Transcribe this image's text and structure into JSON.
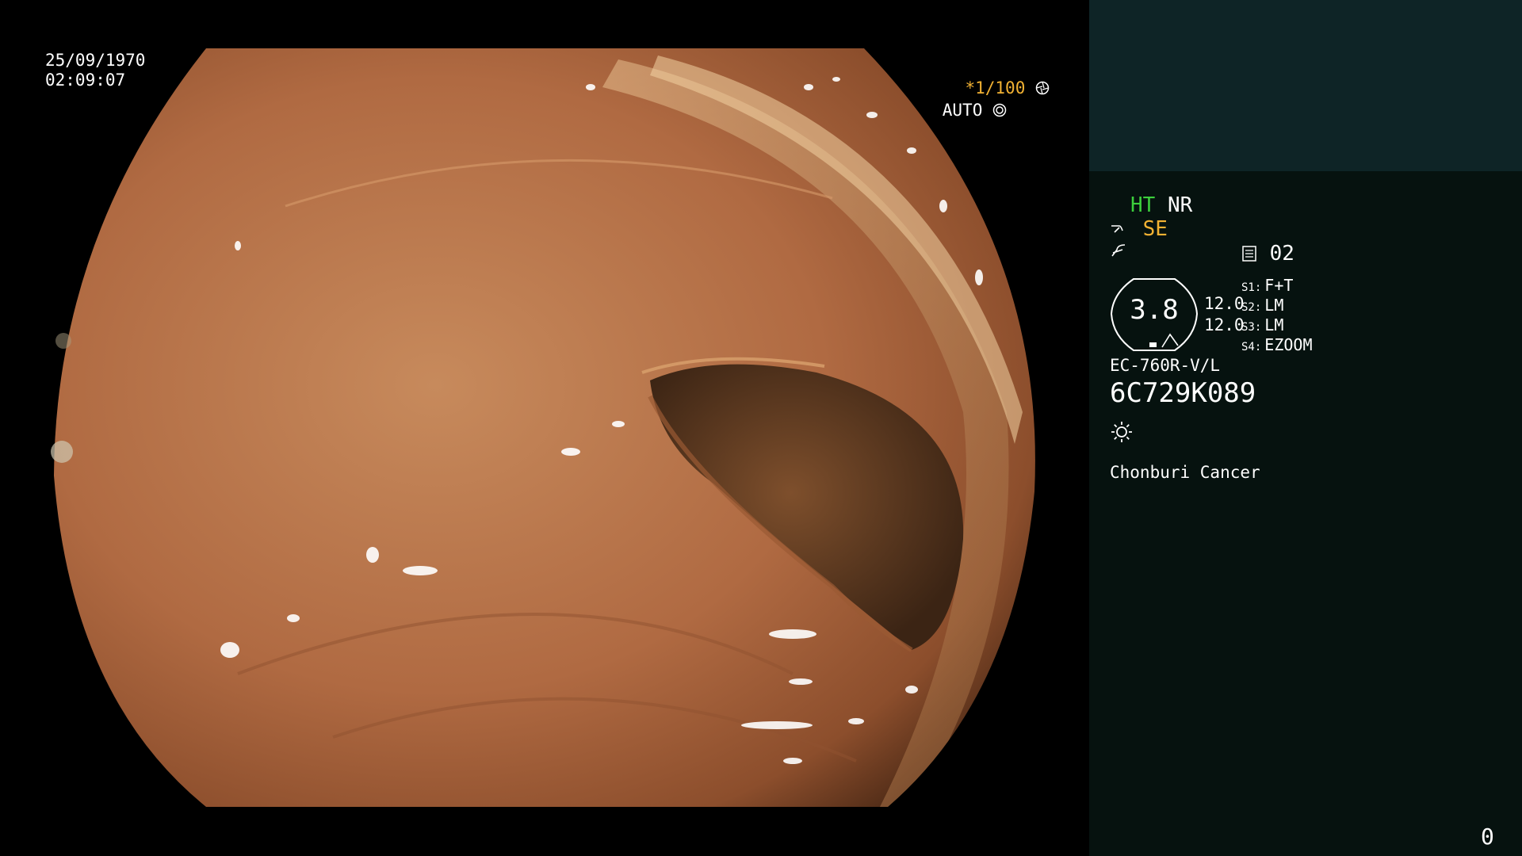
{
  "overlay": {
    "date": "25/09/1970",
    "time": "02:09:07",
    "shutter": "*1/100",
    "shutter_icon": "aperture-icon",
    "iris_mode": "AUTO",
    "iris_icon": "iris-icon"
  },
  "panel": {
    "ht": "HT",
    "nr": "NR",
    "se": "SE",
    "se_icon": "brightness-curve-icon",
    "contrast_icon": "contrast-curve-icon",
    "series_icon": "memory-card-icon",
    "series_no": "02",
    "scope_value": "3.8",
    "zoom_values": [
      "12.0",
      "12.0"
    ],
    "switch_labels": [
      "S1:",
      "S2:",
      "S3:",
      "S4:"
    ],
    "switch_values": [
      "F+T",
      "LM",
      "LM",
      "EZOOM"
    ],
    "scope_model": "EC-760R-V/L",
    "scope_serial": "6C729K089",
    "light_icon": "sun-icon",
    "patient": "Chonburi Cancer",
    "counter": "0"
  },
  "colors": {
    "accent_gold": "#f2b233",
    "accent_green": "#3ccf3c",
    "panel_top": "#0e2426",
    "panel_bottom": "#06120f"
  }
}
